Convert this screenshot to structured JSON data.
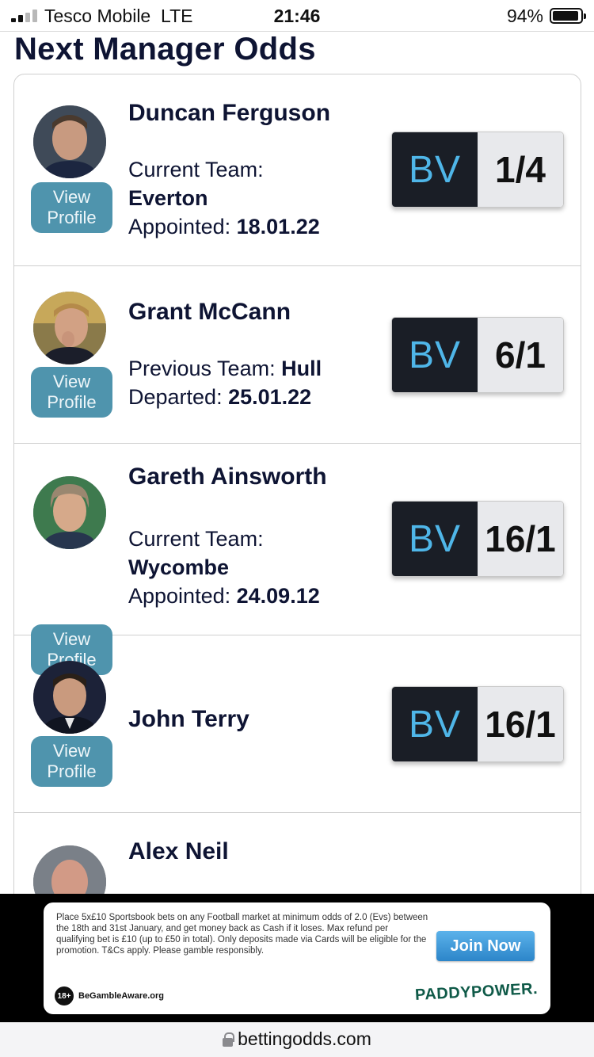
{
  "status_bar": {
    "carrier": "Tesco Mobile",
    "network": "LTE",
    "time": "21:46",
    "battery": "94%",
    "battery_level": 0.94
  },
  "page": {
    "title": "Next Manager Odds"
  },
  "view_profile_label": "View Profile",
  "odds_brand": "BV",
  "managers": [
    {
      "name": "Duncan Ferguson",
      "team_label": "Current Team:",
      "team": "Everton",
      "date_label": "Appointed:",
      "date": "18.01.22",
      "odds": "1/4"
    },
    {
      "name": "Grant McCann",
      "team_label": "Previous Team:",
      "team": "Hull",
      "date_label": "Departed:",
      "date": "25.01.22",
      "odds": "6/1"
    },
    {
      "name": "Gareth Ainsworth",
      "team_label": "Current Team:",
      "team": "Wycombe",
      "date_label": "Appointed:",
      "date": "24.09.12",
      "odds": "16/1"
    },
    {
      "name": "John Terry",
      "odds": "16/1"
    },
    {
      "name": "Alex Neil"
    }
  ],
  "ad": {
    "text": "Place 5x£10 Sportsbook bets on any Football market at minimum odds of 2.0 (Evs) between the 18th and 31st January, and get money back as Cash if it loses. Max refund per qualifying bet is £10 (up to £50 in total). Only deposits made via Cards will be eligible for the promotion. T&Cs apply. Please gamble responsibly.",
    "cta": "Join Now",
    "age_badge": "18+",
    "aware": "BeGambleAware.org",
    "brand": "PADDYPOWER."
  },
  "browser": {
    "url": "bettingodds.com"
  }
}
